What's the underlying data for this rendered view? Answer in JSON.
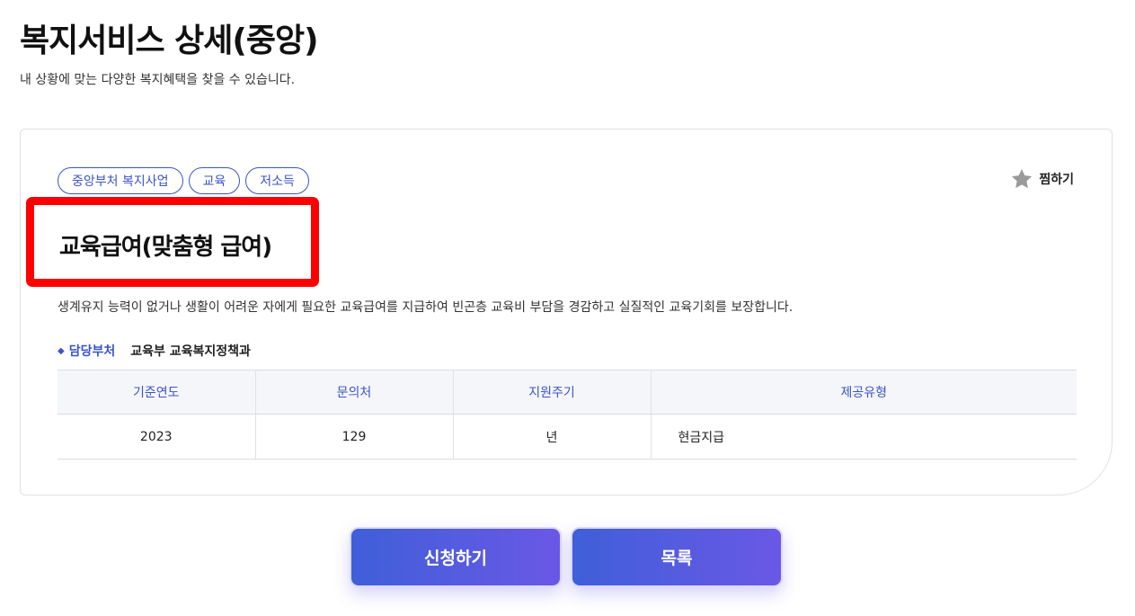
{
  "page": {
    "title": "복지서비스 상세(중앙)",
    "subtitle": "내 상황에 맞는 다양한 복지혜택을 찾을 수 있습니다."
  },
  "service": {
    "tags": [
      "중앙부처 복지사업",
      "교육",
      "저소득"
    ],
    "favorite_label": "찜하기",
    "title": "교육급여(맞춤형 급여)",
    "description": "생계유지 능력이 없거나 생활이 어려운 자에게 필요한 교육급여를 지급하여 빈곤층 교육비 부담을 경감하고 실질적인 교육기회를 보장합니다.",
    "department": {
      "label": "담당부처",
      "value": "교육부 교육복지정책과"
    },
    "table": {
      "headers": [
        "기준연도",
        "문의처",
        "지원주기",
        "제공유형"
      ],
      "row": [
        "2023",
        "129",
        "년",
        "현금지급"
      ]
    }
  },
  "actions": {
    "apply_label": "신청하기",
    "list_label": "목록"
  },
  "colors": {
    "accent": "#3b55c7",
    "highlight_border": "#ff0000",
    "button_gradient_start": "#3f5fd8",
    "button_gradient_end": "#6a58e6"
  },
  "icons": {
    "favorite": "star-icon",
    "dept_bullet": "diamond-bullet-icon"
  }
}
